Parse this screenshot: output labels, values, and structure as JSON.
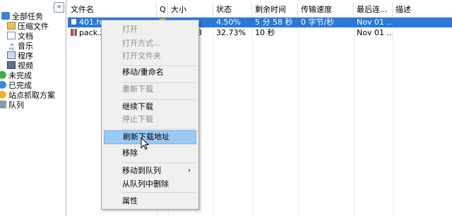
{
  "tree": {
    "collapse_glyph": "«",
    "items": [
      {
        "label": "全部任务",
        "icon": "all-tasks-icon"
      },
      {
        "label": "压缩文件",
        "icon": "archive-folder-icon"
      },
      {
        "label": "文档",
        "icon": "document-icon"
      },
      {
        "label": "音乐",
        "icon": "music-icon"
      },
      {
        "label": "程序",
        "icon": "program-icon"
      },
      {
        "label": "视频",
        "icon": "video-icon"
      },
      {
        "label": "未完成",
        "icon": "unfinished-icon"
      },
      {
        "label": "已完成",
        "icon": "finished-icon"
      },
      {
        "label": "站点抓取方案",
        "icon": "site-grabber-icon"
      },
      {
        "label": "队列",
        "icon": "queue-icon"
      }
    ]
  },
  "columns": {
    "name": "文件名",
    "q": "Q",
    "size": "大小",
    "status": "状态",
    "remaining": "剩余时间",
    "speed": "传输速度",
    "last": "最后连...",
    "desc": "描述"
  },
  "rows": [
    {
      "name": "401.htm",
      "size": "",
      "status": "4.50%",
      "remaining": "5 分 58 秒",
      "speed": "0 字节/秒",
      "last": "Nov 01 ...",
      "desc": "",
      "selected": true
    },
    {
      "name": "pack.zip",
      "size": "3",
      "status": "32.73%",
      "remaining": "10 秒",
      "speed": "",
      "last": "Nov 01 ...",
      "desc": "",
      "selected": false
    }
  ],
  "menu": {
    "open": "打开",
    "open_with": "打开方式...",
    "open_folder": "打开文件夹",
    "move_rename": "移动/重命名",
    "redownload": "重新下载",
    "resume": "继续下载",
    "stop": "停止下载",
    "refresh_address": "刷新下载地址",
    "remove": "移除",
    "move_to_queue": "移动到队列",
    "submenu_arrow": "›",
    "remove_from_queue": "从队列中删除",
    "properties": "属性"
  },
  "colors": {
    "selection": "#2a78d7",
    "menu_hover": "#99c9f5",
    "menu_background": "#f0f0f0"
  }
}
